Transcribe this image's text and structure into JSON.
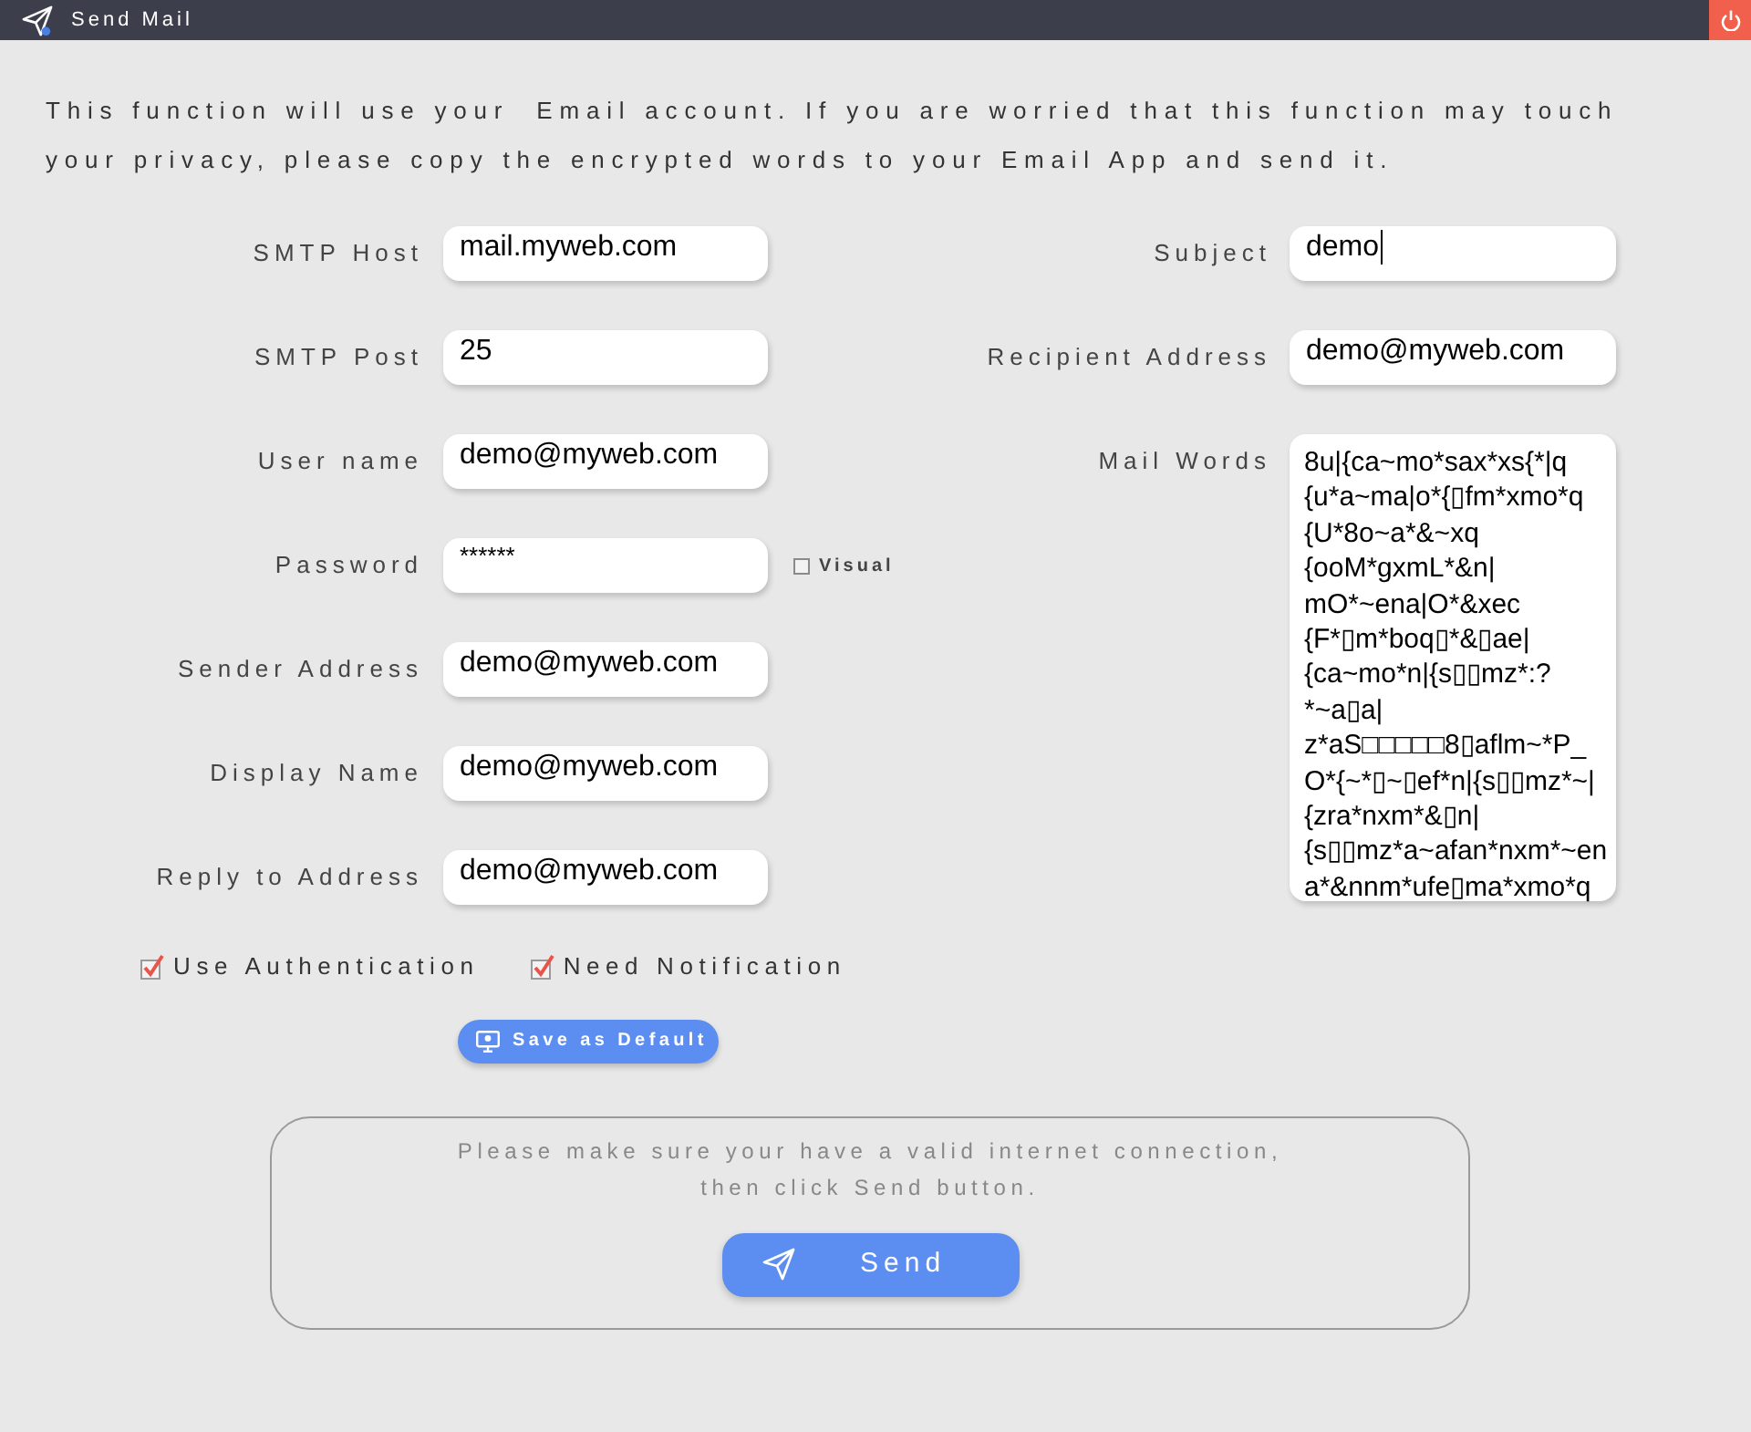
{
  "window": {
    "title": "Send Mail"
  },
  "intro": "This function will use your  Email account. If you are worried that this function may touch your privacy, please copy the encrypted words to your Email App and send it.",
  "left_fields": [
    {
      "kind": "text",
      "label": "SMTP Host",
      "value": "mail.myweb.com"
    },
    {
      "kind": "text",
      "label": "SMTP Post",
      "value": "25"
    },
    {
      "kind": "text",
      "label": "User name",
      "value": "demo@myweb.com"
    },
    {
      "kind": "password",
      "label": "Password",
      "value": "******",
      "visual": {
        "label": "Visual",
        "checked": false
      }
    },
    {
      "kind": "text",
      "label": "Sender Address",
      "value": "demo@myweb.com"
    },
    {
      "kind": "text",
      "label": "Display Name",
      "value": "demo@myweb.com"
    },
    {
      "kind": "text",
      "label": "Reply to Address",
      "value": "demo@myweb.com"
    }
  ],
  "right_fields": [
    {
      "kind": "text",
      "label": "Subject",
      "value": "demo",
      "focused": true
    },
    {
      "kind": "text",
      "label": "Recipient Address",
      "value": "demo@myweb.com"
    },
    {
      "kind": "textarea",
      "label": "Mail Words",
      "value": "8u|{ca~mo*sax*xs{*|q\n{u*a~ma|o*{▯fm*xmo*q\n{U*8o~a*&~xq\n{ooM*gxmL*&n|\nmO*~ena|O*&xec\n{F*▯m*boq▯*&▯ae|\n{ca~mo*n|{s▯▯mz*:?\n*~a▯a|\nz*aS□□□□□8▯aflm~*P_\nO*{~*▯~▯ef*n|{s▯▯mz*~|\n{zra*nxm*&▯n|\n{s▯▯mz*a~afan*nxm*~en\na*&nnm*ufe▯ma*xmo*q"
    }
  ],
  "options": [
    {
      "label": "Use Authentication",
      "checked": true
    },
    {
      "label": "Need Notification",
      "checked": true
    }
  ],
  "save_button": {
    "label": "Save as Default"
  },
  "send_panel": {
    "notice": "Please make sure your have a valid internet connection,\nthen click Send button.",
    "button": "Send"
  }
}
